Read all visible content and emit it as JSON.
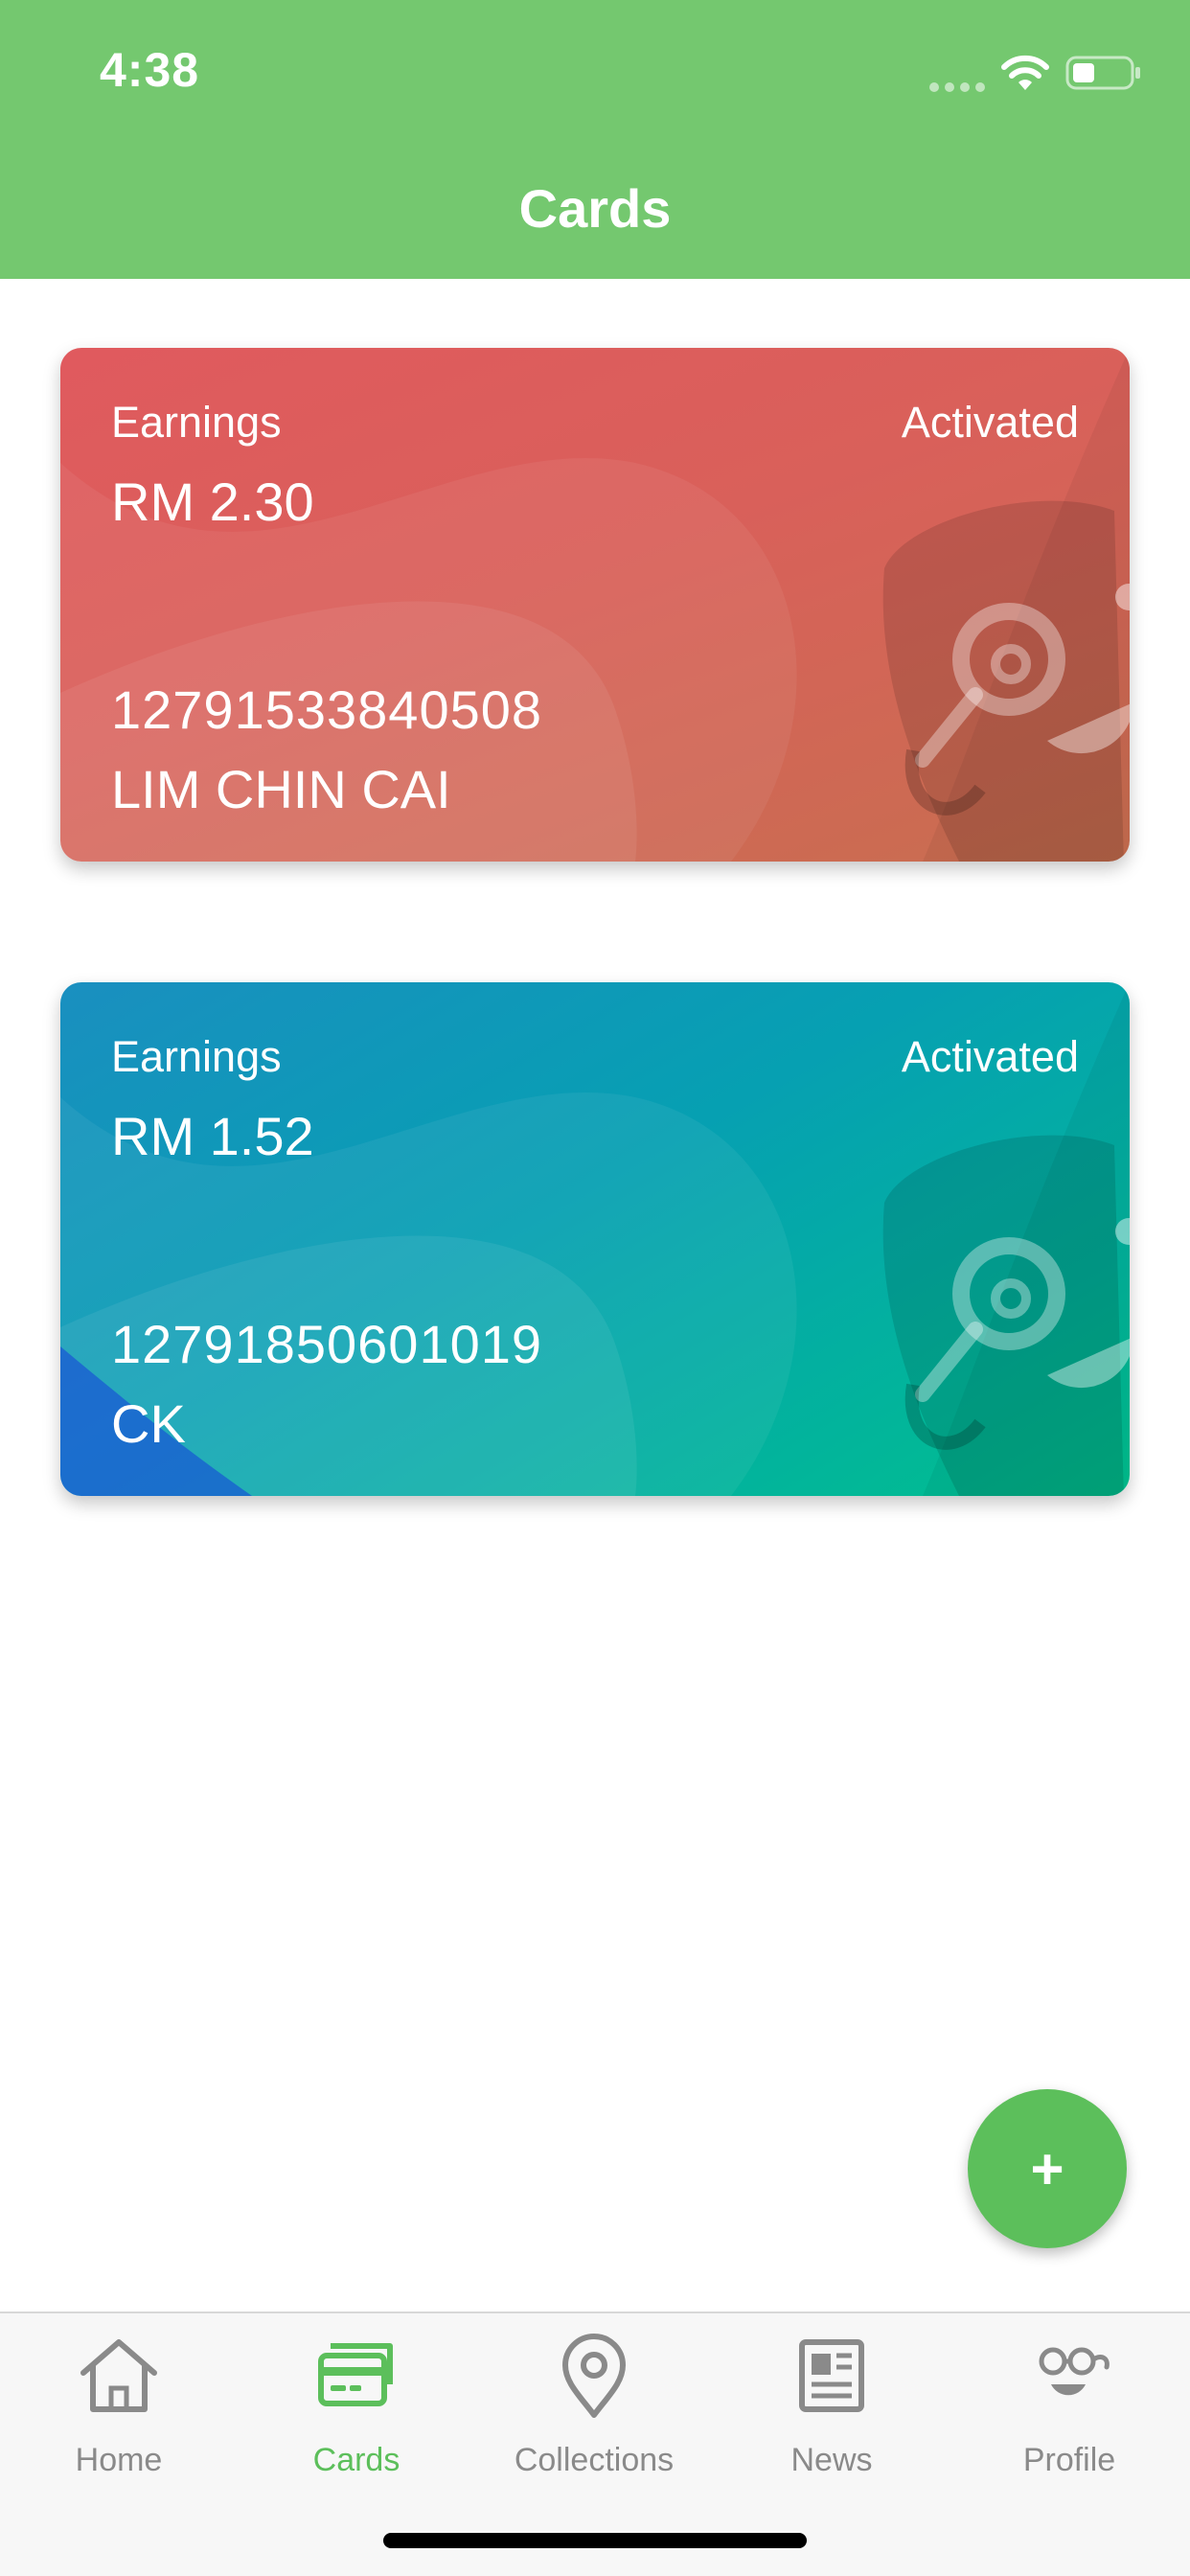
{
  "status_bar": {
    "time": "4:38"
  },
  "header": {
    "title": "Cards"
  },
  "cards": [
    {
      "earnings_label": "Earnings",
      "earnings_value": "RM 2.30",
      "status": "Activated",
      "number": "12791533840508",
      "holder": "LIM CHIN CAI",
      "colors": [
        "#e05a5e",
        "#c86e50"
      ]
    },
    {
      "earnings_label": "Earnings",
      "earnings_value": "RM 1.52",
      "status": "Activated",
      "number": "12791850601019",
      "holder": "CK",
      "colors": [
        "#1a8fc0",
        "#00c08e"
      ]
    }
  ],
  "fab": {
    "label": "+",
    "color": "#5cbf5b"
  },
  "tabs": [
    {
      "label": "Home",
      "icon": "home-icon",
      "active": false
    },
    {
      "label": "Cards",
      "icon": "card-icon",
      "active": true
    },
    {
      "label": "Collections",
      "icon": "location-pin-icon",
      "active": false
    },
    {
      "label": "News",
      "icon": "newspaper-icon",
      "active": false
    },
    {
      "label": "Profile",
      "icon": "profile-glasses-icon",
      "active": false
    }
  ],
  "theme": {
    "primary": "#74c86f",
    "active_tab": "#5cbf5b",
    "inactive_tab": "#8a8a8a"
  }
}
